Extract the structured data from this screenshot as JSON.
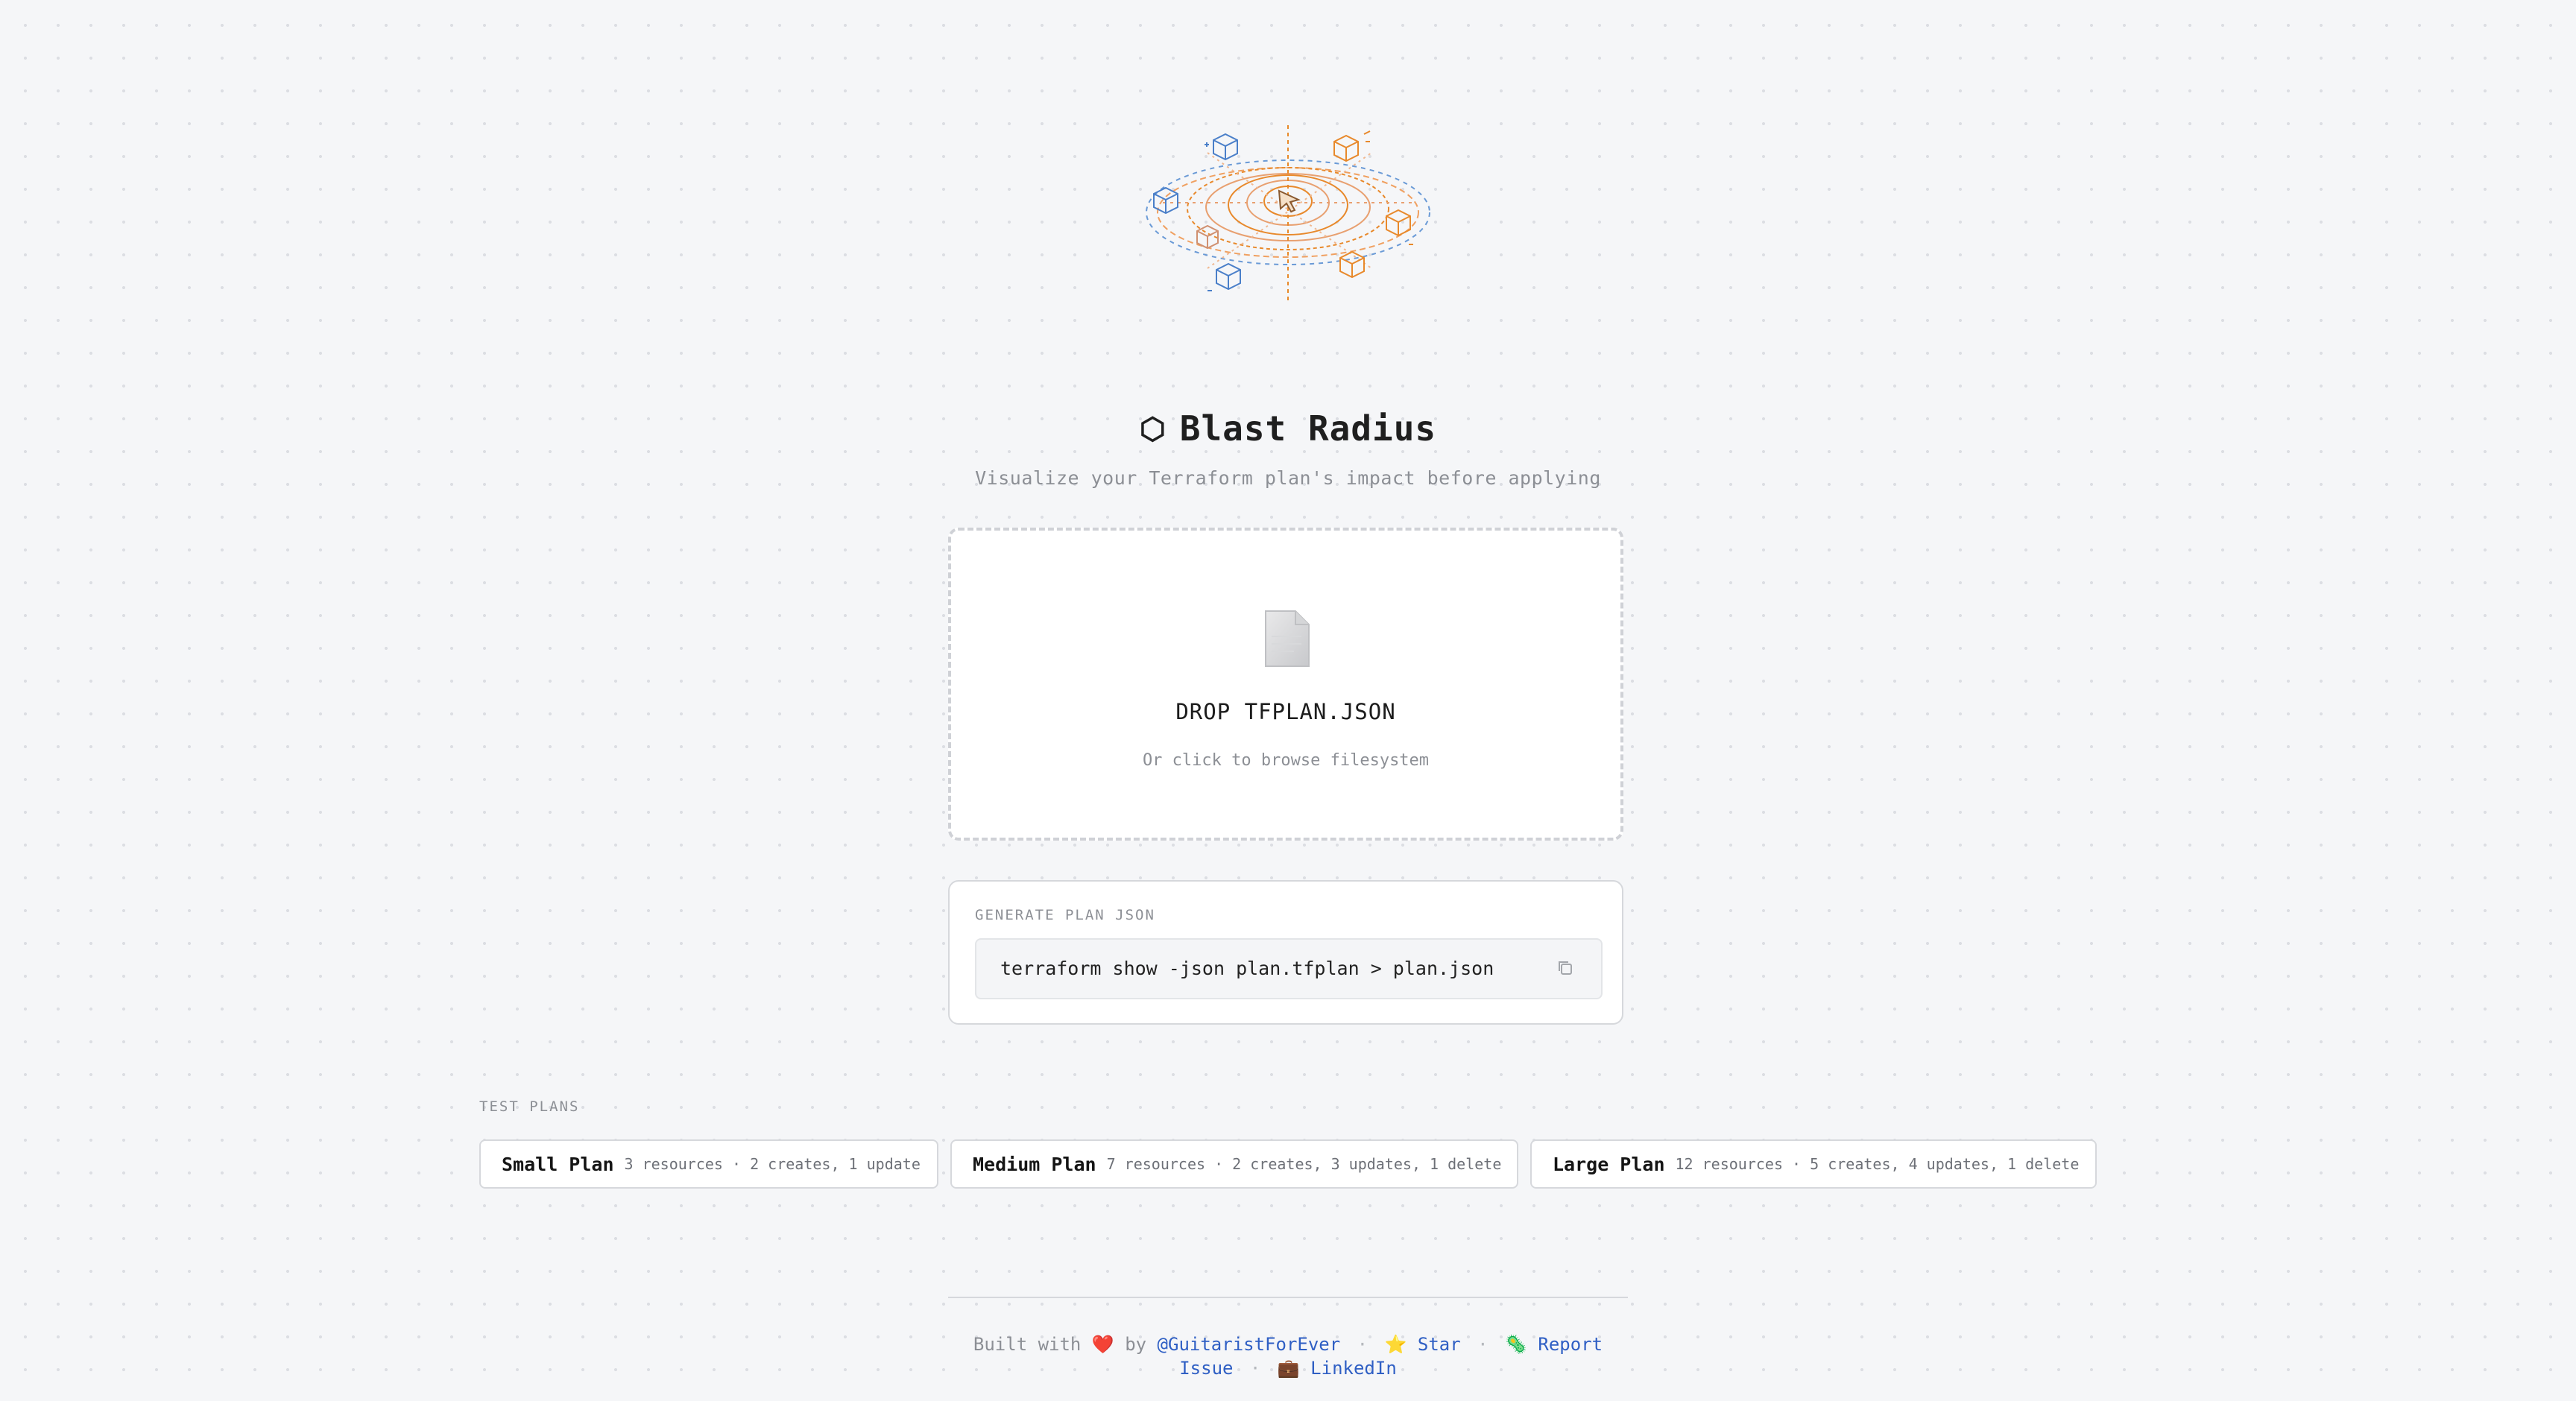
{
  "app": {
    "title": "Blast Radius",
    "title_icon": "⬡",
    "subtitle": "Visualize your Terraform plan's impact before applying"
  },
  "dropzone": {
    "icon": "file-icon",
    "title": "DROP TFPLAN.JSON",
    "subtitle": "Or click to browse filesystem"
  },
  "generate": {
    "label": "GENERATE PLAN JSON",
    "command": "terraform show -json plan.tfplan > plan.json",
    "copy_icon": "copy-icon"
  },
  "test_plans": {
    "label": "TEST PLANS",
    "plans": [
      {
        "name": "Small Plan",
        "meta": "3 resources · 2 creates, 1 update"
      },
      {
        "name": "Medium Plan",
        "meta": "7 resources · 2 creates, 3 updates, 1 delete"
      },
      {
        "name": "Large Plan",
        "meta": "12 resources · 5 creates, 4 updates, 1 delete"
      }
    ]
  },
  "footer": {
    "built_with": "Built with",
    "heart": "❤️",
    "by": "by",
    "author": "@GuitaristForEver",
    "star_icon": "⭐",
    "star": "Star",
    "report_icon": "🦠",
    "report": "Report Issue",
    "linkedin_icon": "💼",
    "linkedin": "LinkedIn",
    "separator": "·"
  },
  "colors": {
    "background": "#f5f6f8",
    "link": "#2f5fc4",
    "blue_accent": "#4a7fc9",
    "orange_accent": "#e8892b"
  }
}
